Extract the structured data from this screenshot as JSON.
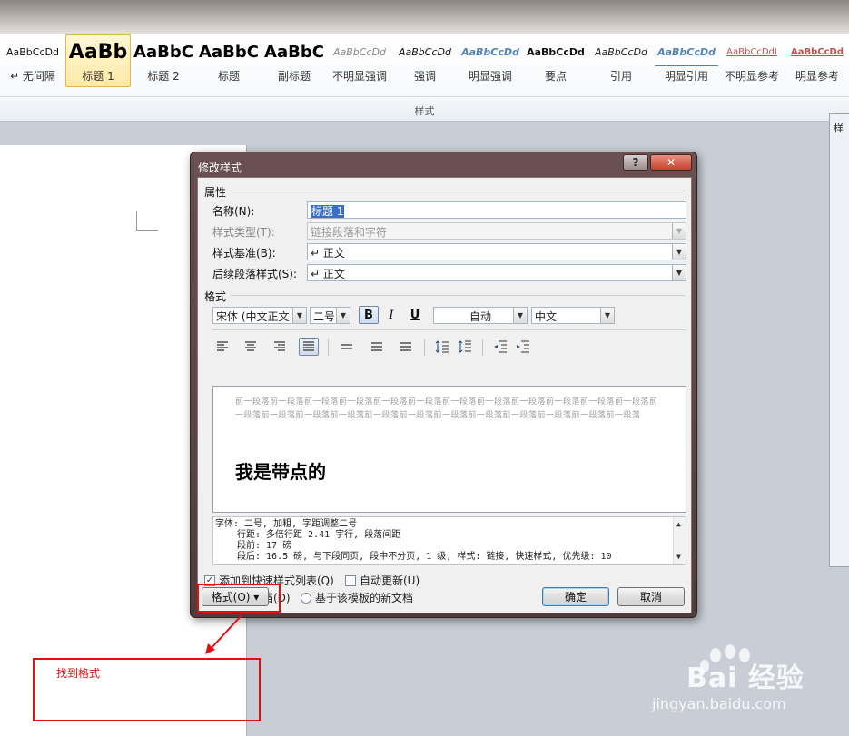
{
  "ribbon": {
    "group_label": "样式",
    "styles": [
      {
        "sample": "AaBbCcDd",
        "label": "↵ 无间隔",
        "cls": "s-normal"
      },
      {
        "sample": "AaBb",
        "label": "标题 1",
        "cls": "s-h1",
        "selected": true
      },
      {
        "sample": "AaBbC",
        "label": "标题 2",
        "cls": "s-h2"
      },
      {
        "sample": "AaBbC",
        "label": "标题",
        "cls": "s-title"
      },
      {
        "sample": "AaBbC",
        "label": "副标题",
        "cls": "s-subtitle"
      },
      {
        "sample": "AaBbCcDd",
        "label": "不明显强调",
        "cls": "s-subtle"
      },
      {
        "sample": "AaBbCcDd",
        "label": "强调",
        "cls": "s-emph"
      },
      {
        "sample": "AaBbCcDd",
        "label": "明显强调",
        "cls": "s-intense"
      },
      {
        "sample": "AaBbCcDd",
        "label": "要点",
        "cls": "s-strong"
      },
      {
        "sample": "AaBbCcDd",
        "label": "引用",
        "cls": "s-quote"
      },
      {
        "sample": "AaBbCcDd",
        "label": "明显引用",
        "cls": "s-iquote"
      },
      {
        "sample": "AaBbCcDdI",
        "label": "不明显参考",
        "cls": "s-subref"
      },
      {
        "sample": "AaBbCcDd",
        "label": "明显参考",
        "cls": "s-iref"
      }
    ]
  },
  "styles_pane": {
    "title": "样"
  },
  "dialog": {
    "title": "修改样式",
    "help_label": "?",
    "close_label": "✕",
    "properties_label": "属性",
    "name_label": "名称(N):",
    "name_value": "标题 1",
    "style_type_label": "样式类型(T):",
    "style_type_value": "链接段落和字符",
    "based_on_label": "样式基准(B):",
    "based_on_value": "↵ 正文",
    "following_label": "后续段落样式(S):",
    "following_value": "↵ 正文",
    "format_label": "格式",
    "font_value": "宋体 (中文正文",
    "size_value": "二号",
    "bold_label": "B",
    "italic_label": "I",
    "underline_label": "U",
    "color_value": "自动",
    "lang_value": "中文",
    "preview_prev_text": "前一段落前一段落前一段落前一段落前一段落前一段落前一段落前一段落前一段落前一段落前一段落前一段落前一段落前一段落前一段落前一段落前一段落前一段落前一段落前一段落前一段落前一段落前一段落前一段落",
    "preview_sample": "我是带点的",
    "desc_line1": "字体: 二号, 加粗, 字距调整二号",
    "desc_line2": "行距: 多倍行距 2.41 字行, 段落间距",
    "desc_line3": "段前: 17 磅",
    "desc_line4": "段后: 16.5 磅, 与下段同页, 段中不分页, 1 级, 样式: 链接, 快速样式, 优先级: 10",
    "add_quick_label": "添加到快速样式列表(Q)",
    "auto_update_label": "自动更新(U)",
    "only_doc_label": "仅限此文档(D)",
    "template_label": "基于该模板的新文档",
    "format_button": "格式(O) ▾",
    "ok_button": "确定",
    "cancel_button": "取消"
  },
  "annotation": {
    "text": "找到格式"
  },
  "watermark": {
    "text": "Bai 经验",
    "url": "jingyan.baidu.com"
  }
}
